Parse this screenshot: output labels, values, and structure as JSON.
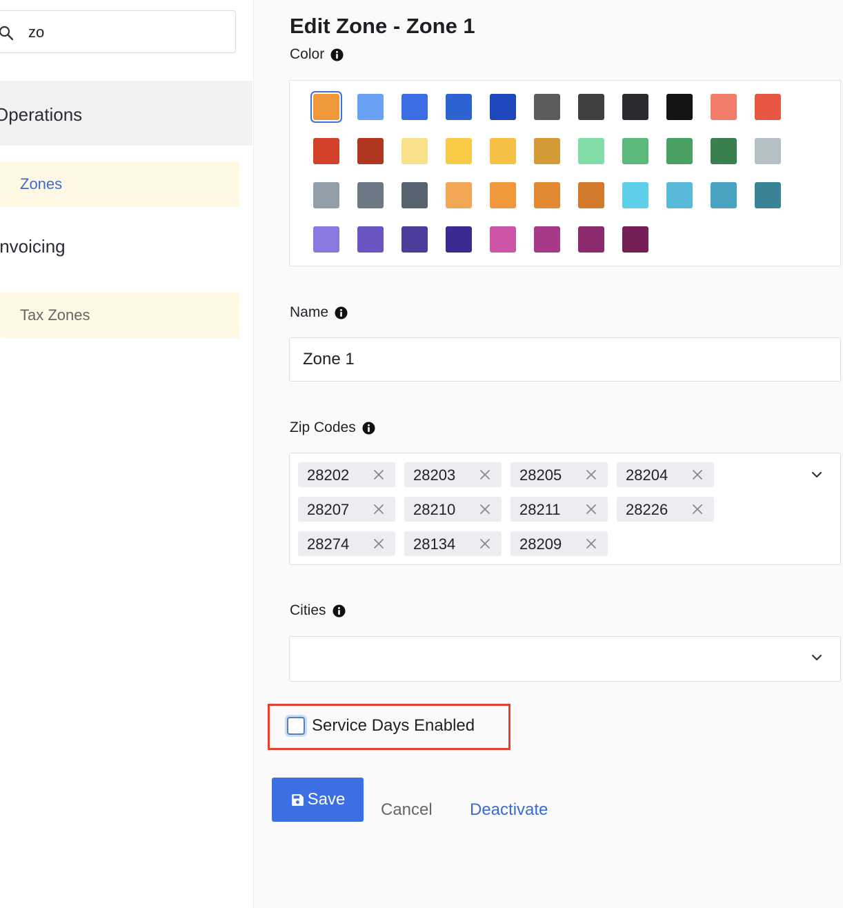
{
  "sidebar": {
    "search": {
      "value": "zo",
      "placeholder": ""
    },
    "groups": [
      {
        "title": "Operations",
        "items": [
          {
            "label": "Zones",
            "active": true,
            "color": "#3a6ad6"
          }
        ]
      },
      {
        "title": "Invoicing",
        "items": [
          {
            "label": "Tax Zones",
            "active": false,
            "color": "#666666"
          }
        ]
      }
    ]
  },
  "main": {
    "title": "Edit Zone - Zone 1",
    "color_field": {
      "label": "Color",
      "selected_index": 0,
      "swatches": [
        "#f0973c",
        "#69a1f7",
        "#3b6ee3",
        "#2d62d1",
        "#1d47ba",
        "#5c5c5e",
        "#404042",
        "#2a2b2e",
        "#141414",
        "#f07c69",
        "#e65640",
        "#d4412a",
        "#b0371f",
        "#f8e08a",
        "#f7cb45",
        "#f5c043",
        "#d49a35",
        "#82dca8",
        "#5ab97b",
        "#4a9f63",
        "#3a7f4e",
        "#b5bfc6",
        "#939fa8",
        "#6c7984",
        "#56636e",
        "#f2a757",
        "#f0963b",
        "#e28a31",
        "#d27a2c",
        "#5ecfe8",
        "#58bad9",
        "#4aa3c0",
        "#3a8397",
        "#8a78e0",
        "#6a54c2",
        "#4e3c9b",
        "#3c2a92",
        "#cc55a8",
        "#a63a88",
        "#8b2a6e",
        "#761f57"
      ]
    },
    "name_field": {
      "label": "Name",
      "value": "Zone 1"
    },
    "zip_field": {
      "label": "Zip Codes",
      "chips": [
        "28202",
        "28203",
        "28205",
        "28204",
        "28207",
        "28210",
        "28211",
        "28226",
        "28274",
        "28134",
        "28209"
      ]
    },
    "cities_field": {
      "label": "Cities",
      "value": ""
    },
    "service_days": {
      "label": "Service Days Enabled",
      "checked": false
    },
    "actions": {
      "save": "Save",
      "cancel": "Cancel",
      "deactivate": "Deactivate"
    },
    "icons": {
      "search": "search-icon",
      "info": "info-icon",
      "remove": "close-icon",
      "dropdown": "chevron-down-icon",
      "save": "floppy-disk-icon"
    },
    "accent_color": "#3b6fe2",
    "highlight_color": "#e2412c"
  }
}
